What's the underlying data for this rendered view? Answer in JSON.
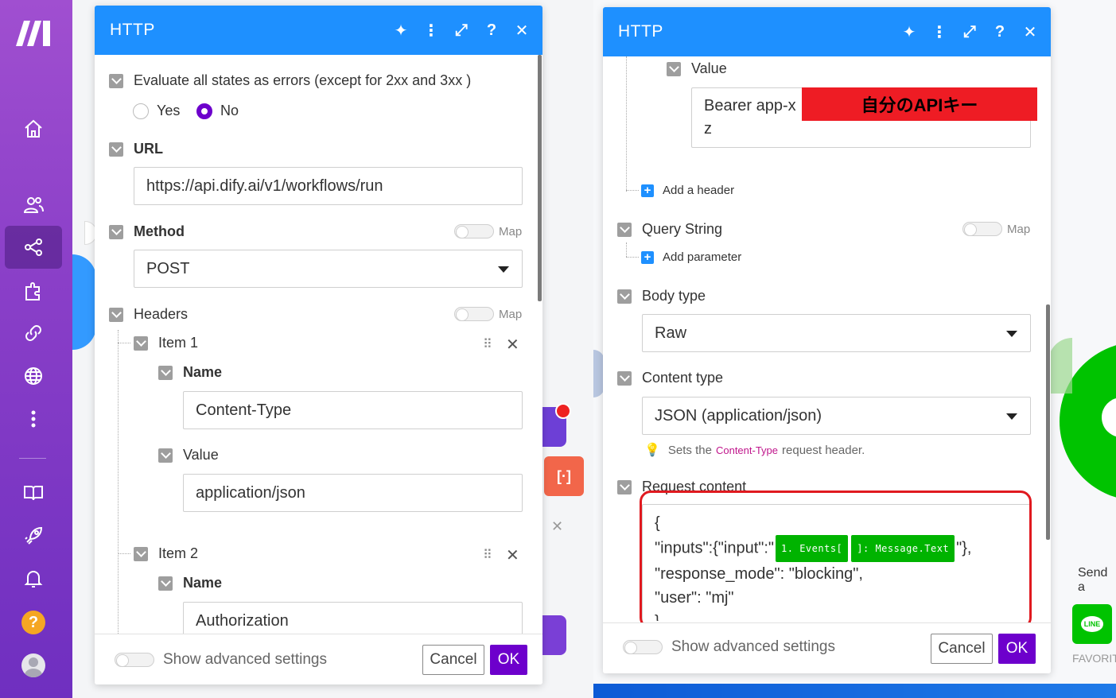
{
  "brand": {
    "primary": "#1e90ff",
    "accent": "#6d00cc",
    "sidebar": "#8a3fc8",
    "highlight": "#e0191f",
    "pill": "#00b300"
  },
  "sidebar": {
    "help_label": "?"
  },
  "left_dialog": {
    "title": "HTTP",
    "evaluate_label": "Evaluate all states as errors (except for 2xx and 3xx )",
    "radio_yes": "Yes",
    "radio_no": "No",
    "url_label": "URL",
    "url_value": "https://api.dify.ai/v1/workflows/run",
    "method_label": "Method",
    "method_value": "POST",
    "map_label": "Map",
    "headers_label": "Headers",
    "item1_label": "Item 1",
    "item2_label": "Item 2",
    "name_label": "Name",
    "value_label": "Value",
    "item1_name": "Content-Type",
    "item1_value": "application/json",
    "item2_name": "Authorization",
    "advanced_label": "Show advanced settings",
    "cancel_label": "Cancel",
    "ok_label": "OK"
  },
  "right_dialog": {
    "title": "HTTP",
    "value_label": "Value",
    "value_text_line1": "Bearer app-x",
    "value_text_line2": "z",
    "redaction_label": "自分のAPIキー",
    "add_header_label": "Add a header",
    "query_label": "Query String",
    "map_label": "Map",
    "add_param_label": "Add parameter",
    "body_type_label": "Body type",
    "body_type_value": "Raw",
    "content_type_label": "Content type",
    "content_type_value": "JSON (application/json)",
    "hint_prefix": "Sets the",
    "hint_code": "Content-Type",
    "hint_suffix": "request header.",
    "request_content_label": "Request content",
    "code_line1": "{",
    "code_line2_prefix": "\"inputs\":{\"input\":\"",
    "code_pill1": "1. Events[",
    "code_pill2": "]: Message.Text",
    "code_line2_suffix": "\"},",
    "code_line3": "\"response_mode\": \"blocking\",",
    "code_line4": "\"user\": \"mj\"",
    "code_line5": "}",
    "advanced_label": "Show advanced settings",
    "cancel_label": "Cancel",
    "ok_label": "OK"
  },
  "canvas": {
    "send_label": "Send a",
    "favorite_label": "FAVORIT",
    "line_label": "LINE"
  }
}
